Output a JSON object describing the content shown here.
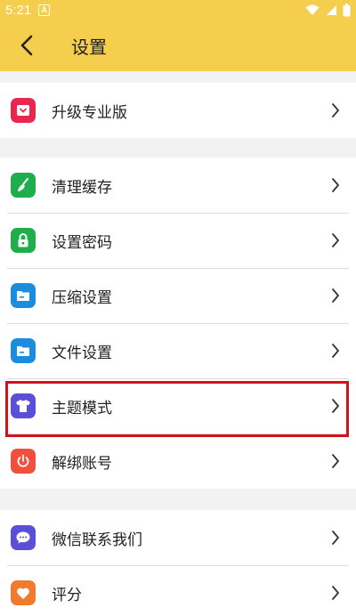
{
  "status_bar": {
    "time": "5:21",
    "notif_letter": "A"
  },
  "header": {
    "title": "设置"
  },
  "groups": [
    {
      "items": [
        {
          "label": "升级专业版",
          "icon": "pro-badge-icon",
          "color": "#e9284f"
        }
      ]
    },
    {
      "items": [
        {
          "label": "清理缓存",
          "icon": "broom-icon",
          "color": "#1fae4c"
        },
        {
          "label": "设置密码",
          "icon": "lock-icon",
          "color": "#1fae4c"
        },
        {
          "label": "压缩设置",
          "icon": "folder-icon",
          "color": "#1a8de0"
        },
        {
          "label": "文件设置",
          "icon": "folder-icon",
          "color": "#1a8de0"
        },
        {
          "label": "主题模式",
          "icon": "shirt-icon",
          "color": "#5b4fd8"
        },
        {
          "label": "解绑账号",
          "icon": "power-icon",
          "color": "#f0503c"
        }
      ]
    },
    {
      "items": [
        {
          "label": "微信联系我们",
          "icon": "chat-icon",
          "color": "#5b4fd8"
        },
        {
          "label": "评分",
          "icon": "heart-icon",
          "color": "#f07a2e"
        }
      ]
    }
  ],
  "colors": {
    "app_bar": "#f5ce4e",
    "highlight": "#d0121b",
    "background": "#f2f2f2"
  }
}
